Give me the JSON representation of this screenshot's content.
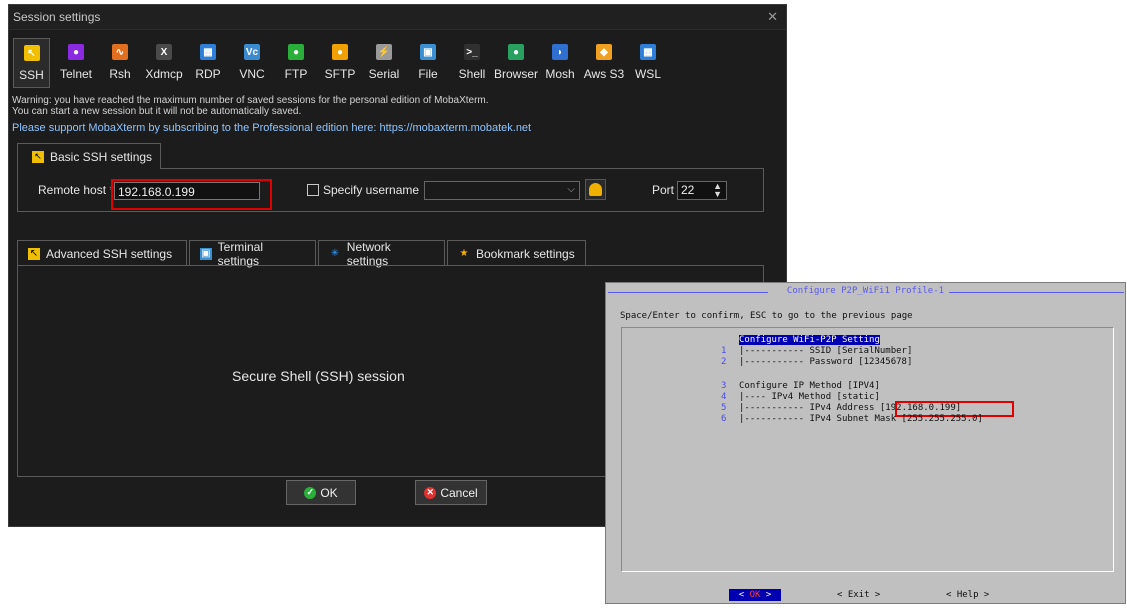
{
  "moba": {
    "title": "Session settings",
    "close_glyph": "✕",
    "session_types": [
      {
        "label": "SSH",
        "icon": "ssh-icon",
        "color": "#f0c000",
        "glyph": "↖"
      },
      {
        "label": "Telnet",
        "icon": "telnet-icon",
        "color": "#8a2be2",
        "glyph": "●"
      },
      {
        "label": "Rsh",
        "icon": "rsh-icon",
        "color": "#e07020",
        "glyph": "∿"
      },
      {
        "label": "Xdmcp",
        "icon": "xdmcp-icon",
        "color": "#4a4a4a",
        "glyph": "X"
      },
      {
        "label": "RDP",
        "icon": "rdp-icon",
        "color": "#2f7fd8",
        "glyph": "▦"
      },
      {
        "label": "VNC",
        "icon": "vnc-icon",
        "color": "#3a8ad0",
        "glyph": "Vc"
      },
      {
        "label": "FTP",
        "icon": "ftp-icon",
        "color": "#2ab03a",
        "glyph": "●"
      },
      {
        "label": "SFTP",
        "icon": "sftp-icon",
        "color": "#f0a000",
        "glyph": "●"
      },
      {
        "label": "Serial",
        "icon": "serial-icon",
        "color": "#9a9a9a",
        "glyph": "⚡"
      },
      {
        "label": "File",
        "icon": "file-icon",
        "color": "#3a90d0",
        "glyph": "▣"
      },
      {
        "label": "Shell",
        "icon": "shell-icon",
        "color": "#303030",
        "glyph": ">_"
      },
      {
        "label": "Browser",
        "icon": "browser-icon",
        "color": "#2aa060",
        "glyph": "●"
      },
      {
        "label": "Mosh",
        "icon": "mosh-icon",
        "color": "#2f6fd0",
        "glyph": "◗"
      },
      {
        "label": "Aws S3",
        "icon": "aws-s3-icon",
        "color": "#f0a020",
        "glyph": "◆"
      },
      {
        "label": "WSL",
        "icon": "wsl-icon",
        "color": "#2f7fd8",
        "glyph": "▦"
      }
    ],
    "warning_line1": "Warning: you have reached the maximum number of saved sessions for the personal edition of MobaXterm.",
    "warning_line2": "You can start a new session but it will not be automatically saved.",
    "support_line": "Please support MobaXterm by subscribing to the Professional edition here: https://mobaxterm.mobatek.net",
    "basic_tab_label": "Basic SSH settings",
    "remote_host_label": "Remote host",
    "required_mark": "*",
    "remote_host_value": "192.168.0.199",
    "specify_username_label": "Specify username",
    "username_value": "",
    "port_label": "Port",
    "port_value": "22",
    "sub_tabs": [
      {
        "label": "Advanced SSH settings",
        "icon": "advanced-ssh-icon"
      },
      {
        "label": "Terminal settings",
        "icon": "terminal-icon"
      },
      {
        "label": "Network settings",
        "icon": "network-icon"
      },
      {
        "label": "Bookmark settings",
        "icon": "star-icon"
      }
    ],
    "panel_text": "Secure Shell (SSH) session",
    "ok_label": "OK",
    "cancel_label": "Cancel",
    "colors": {
      "bg": "#1c1c1c",
      "highlight_red": "#e00000",
      "link_blue": "#8ec4ff"
    }
  },
  "terminal": {
    "title": "Configure P2P_WiFi1 Profile-1",
    "hint": "Space/Enter to confirm, ESC to go to the previous page",
    "heading": "Configure WiFi-P2P Setting",
    "items": [
      {
        "num": "1",
        "text": "|----------- SSID [SerialNumber]"
      },
      {
        "num": "2",
        "text": "|----------- Password [12345678]"
      },
      {
        "num": "3",
        "text": "Configure IP Method [IPV4]"
      },
      {
        "num": "4",
        "text": "|---- IPv4 Method [static]"
      },
      {
        "num": "5",
        "text": "|----------- IPv4 Address ",
        "extra": "[192.168.0.199]"
      },
      {
        "num": "6",
        "text": "|----------- IPv4 Subnet Mask [255.255.255.0]"
      }
    ],
    "ok_left": "<",
    "ok_label": "OK",
    "ok_right": ">",
    "exit_label": "< Exit >",
    "help_label": "< Help >",
    "colors": {
      "bg": "#c0c0c0",
      "title": "#5a5aee",
      "selection": "#0000b0"
    }
  }
}
